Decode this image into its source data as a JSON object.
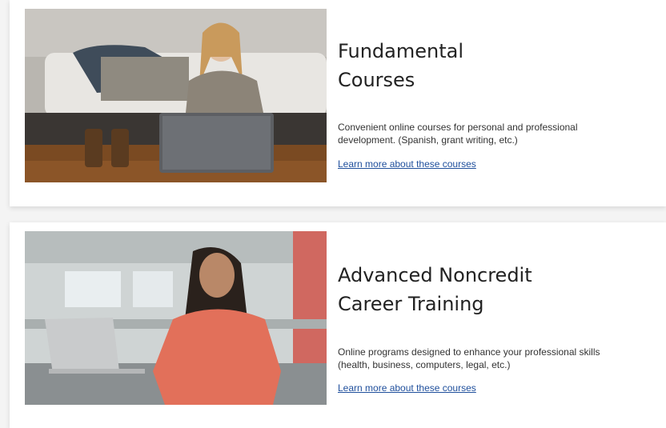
{
  "cards": [
    {
      "title_line1": "Fundamental",
      "title_line2": "Courses",
      "description_line1": "Convenient online courses for personal and professional",
      "description_line2": "development. (Spanish, grant writing, etc.)",
      "link": "Learn more about these courses",
      "image_alt": "Woman sitting in front of a bed using a laptop"
    },
    {
      "title_line1": "Advanced Noncredit",
      "title_line2": "Career Training",
      "description_line1": "Online programs designed to enhance your professional skills",
      "description_line2": "(health, business, computers, legal, etc.)",
      "link": "Learn more about these courses",
      "image_alt": "Woman in coral top standing at a counter with a laptop in an office"
    }
  ],
  "colors": {
    "link": "#1f4f9c",
    "title": "#222222",
    "text": "#333333"
  }
}
